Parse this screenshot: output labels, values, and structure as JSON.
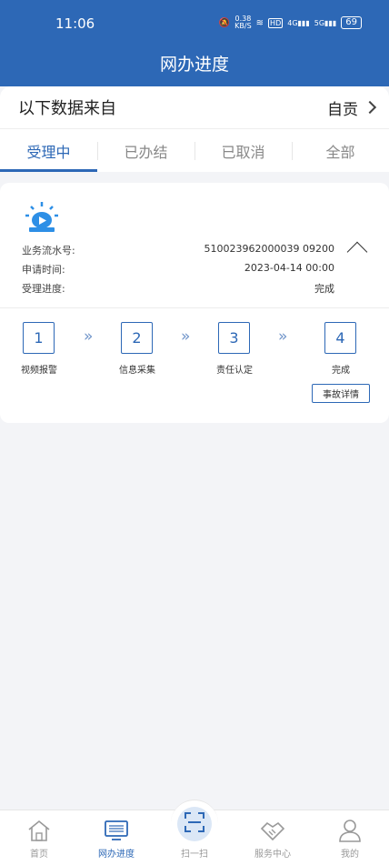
{
  "status_bar": {
    "time": "11:06",
    "speed_value": "0.38",
    "speed_unit": "KB/S",
    "hd_label": "HD",
    "net1": "4G",
    "net2": "5G",
    "battery": "69"
  },
  "header": {
    "title": "网办进度"
  },
  "source": {
    "label": "以下数据来自",
    "value": "自贡"
  },
  "tabs": [
    {
      "label": "受理中",
      "active": true
    },
    {
      "label": "已办结",
      "active": false
    },
    {
      "label": "已取消",
      "active": false
    },
    {
      "label": "全部",
      "active": false
    }
  ],
  "card": {
    "icon": "alarm-siren-icon",
    "serial_label": "业务流水号:",
    "serial_value": "510023962000039 09200",
    "apply_time_label": "申请时间:",
    "apply_time_value": "2023-04-14 00:00",
    "progress_label": "受理进度:",
    "progress_value": "完成",
    "steps": [
      {
        "num": "1",
        "label": "视频报警"
      },
      {
        "num": "2",
        "label": "信息采集"
      },
      {
        "num": "3",
        "label": "责任认定"
      },
      {
        "num": "4",
        "label": "完成"
      }
    ],
    "step_arrow": "»",
    "detail_button": "事故详情"
  },
  "bottom_nav": [
    {
      "label": "首页",
      "icon": "home-icon",
      "active": false
    },
    {
      "label": "网办进度",
      "icon": "monitor-icon",
      "active": true
    },
    {
      "label": "扫一扫",
      "icon": "scan-icon",
      "active": false
    },
    {
      "label": "服务中心",
      "icon": "handshake-icon",
      "active": false
    },
    {
      "label": "我的",
      "icon": "user-icon",
      "active": false
    }
  ],
  "colors": {
    "primary": "#2d68b6",
    "background": "#f3f4f7"
  }
}
